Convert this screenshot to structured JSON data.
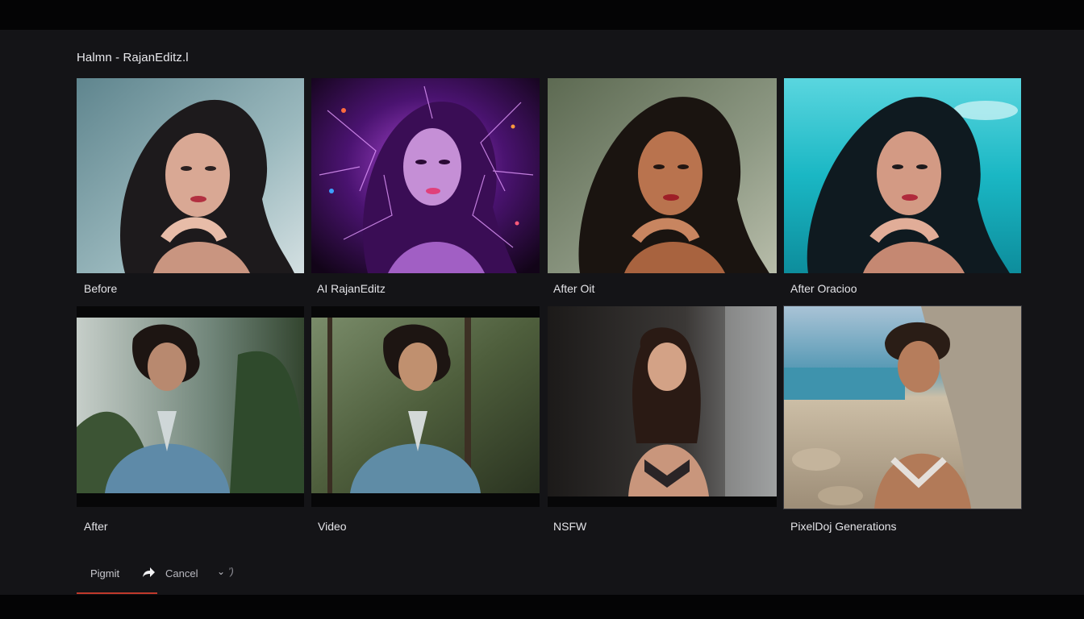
{
  "window": {
    "title": "Halmn - RajanEditz.l"
  },
  "gallery": {
    "row1": [
      {
        "caption": "Before",
        "scene": "portrait-woman-cool",
        "bg": "#7fa3ab"
      },
      {
        "caption": "AI RajanEditz",
        "scene": "portrait-woman-neon",
        "bg": "#2a0a3a"
      },
      {
        "caption": "After Oit",
        "scene": "portrait-woman-warm",
        "bg": "#7d8870"
      },
      {
        "caption": "After Oracioo",
        "scene": "portrait-woman-teal",
        "bg": "#19c6cf"
      }
    ],
    "row2": [
      {
        "caption": "After",
        "scene": "man-forest-mist",
        "bg": "#9aa7a2"
      },
      {
        "caption": "Video",
        "scene": "man-forest-green",
        "bg": "#5d6d4d"
      },
      {
        "caption": "NSFW",
        "scene": "woman-street-dark",
        "bg": "#2c2a2a"
      },
      {
        "caption": "PixelDoj Generations",
        "scene": "man-beach-rocks",
        "bg": "#b7aa95"
      }
    ]
  },
  "bottom_bar": {
    "tab_label": "Pigmit",
    "share_icon": "share-arrow-icon",
    "cancel_label": "Cancel",
    "dropdown_icon": "chevron-down-icon",
    "extra_mark": "’)"
  }
}
